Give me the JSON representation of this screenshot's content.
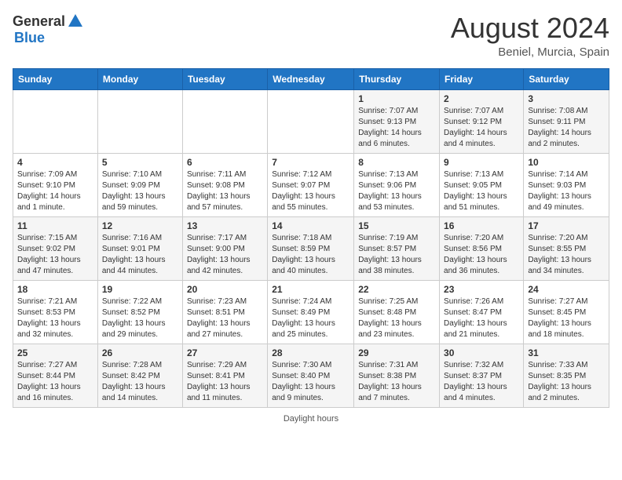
{
  "header": {
    "logo_general": "General",
    "logo_blue": "Blue",
    "month_year": "August 2024",
    "location": "Beniel, Murcia, Spain"
  },
  "weekdays": [
    "Sunday",
    "Monday",
    "Tuesday",
    "Wednesday",
    "Thursday",
    "Friday",
    "Saturday"
  ],
  "weeks": [
    [
      null,
      null,
      null,
      null,
      {
        "day": "1",
        "sunrise": "7:07 AM",
        "sunset": "9:13 PM",
        "daylight": "14 hours and 6 minutes."
      },
      {
        "day": "2",
        "sunrise": "7:07 AM",
        "sunset": "9:12 PM",
        "daylight": "14 hours and 4 minutes."
      },
      {
        "day": "3",
        "sunrise": "7:08 AM",
        "sunset": "9:11 PM",
        "daylight": "14 hours and 2 minutes."
      }
    ],
    [
      {
        "day": "4",
        "sunrise": "7:09 AM",
        "sunset": "9:10 PM",
        "daylight": "14 hours and 1 minute."
      },
      {
        "day": "5",
        "sunrise": "7:10 AM",
        "sunset": "9:09 PM",
        "daylight": "13 hours and 59 minutes."
      },
      {
        "day": "6",
        "sunrise": "7:11 AM",
        "sunset": "9:08 PM",
        "daylight": "13 hours and 57 minutes."
      },
      {
        "day": "7",
        "sunrise": "7:12 AM",
        "sunset": "9:07 PM",
        "daylight": "13 hours and 55 minutes."
      },
      {
        "day": "8",
        "sunrise": "7:13 AM",
        "sunset": "9:06 PM",
        "daylight": "13 hours and 53 minutes."
      },
      {
        "day": "9",
        "sunrise": "7:13 AM",
        "sunset": "9:05 PM",
        "daylight": "13 hours and 51 minutes."
      },
      {
        "day": "10",
        "sunrise": "7:14 AM",
        "sunset": "9:03 PM",
        "daylight": "13 hours and 49 minutes."
      }
    ],
    [
      {
        "day": "11",
        "sunrise": "7:15 AM",
        "sunset": "9:02 PM",
        "daylight": "13 hours and 47 minutes."
      },
      {
        "day": "12",
        "sunrise": "7:16 AM",
        "sunset": "9:01 PM",
        "daylight": "13 hours and 44 minutes."
      },
      {
        "day": "13",
        "sunrise": "7:17 AM",
        "sunset": "9:00 PM",
        "daylight": "13 hours and 42 minutes."
      },
      {
        "day": "14",
        "sunrise": "7:18 AM",
        "sunset": "8:59 PM",
        "daylight": "13 hours and 40 minutes."
      },
      {
        "day": "15",
        "sunrise": "7:19 AM",
        "sunset": "8:57 PM",
        "daylight": "13 hours and 38 minutes."
      },
      {
        "day": "16",
        "sunrise": "7:20 AM",
        "sunset": "8:56 PM",
        "daylight": "13 hours and 36 minutes."
      },
      {
        "day": "17",
        "sunrise": "7:20 AM",
        "sunset": "8:55 PM",
        "daylight": "13 hours and 34 minutes."
      }
    ],
    [
      {
        "day": "18",
        "sunrise": "7:21 AM",
        "sunset": "8:53 PM",
        "daylight": "13 hours and 32 minutes."
      },
      {
        "day": "19",
        "sunrise": "7:22 AM",
        "sunset": "8:52 PM",
        "daylight": "13 hours and 29 minutes."
      },
      {
        "day": "20",
        "sunrise": "7:23 AM",
        "sunset": "8:51 PM",
        "daylight": "13 hours and 27 minutes."
      },
      {
        "day": "21",
        "sunrise": "7:24 AM",
        "sunset": "8:49 PM",
        "daylight": "13 hours and 25 minutes."
      },
      {
        "day": "22",
        "sunrise": "7:25 AM",
        "sunset": "8:48 PM",
        "daylight": "13 hours and 23 minutes."
      },
      {
        "day": "23",
        "sunrise": "7:26 AM",
        "sunset": "8:47 PM",
        "daylight": "13 hours and 21 minutes."
      },
      {
        "day": "24",
        "sunrise": "7:27 AM",
        "sunset": "8:45 PM",
        "daylight": "13 hours and 18 minutes."
      }
    ],
    [
      {
        "day": "25",
        "sunrise": "7:27 AM",
        "sunset": "8:44 PM",
        "daylight": "13 hours and 16 minutes."
      },
      {
        "day": "26",
        "sunrise": "7:28 AM",
        "sunset": "8:42 PM",
        "daylight": "13 hours and 14 minutes."
      },
      {
        "day": "27",
        "sunrise": "7:29 AM",
        "sunset": "8:41 PM",
        "daylight": "13 hours and 11 minutes."
      },
      {
        "day": "28",
        "sunrise": "7:30 AM",
        "sunset": "8:40 PM",
        "daylight": "13 hours and 9 minutes."
      },
      {
        "day": "29",
        "sunrise": "7:31 AM",
        "sunset": "8:38 PM",
        "daylight": "13 hours and 7 minutes."
      },
      {
        "day": "30",
        "sunrise": "7:32 AM",
        "sunset": "8:37 PM",
        "daylight": "13 hours and 4 minutes."
      },
      {
        "day": "31",
        "sunrise": "7:33 AM",
        "sunset": "8:35 PM",
        "daylight": "13 hours and 2 minutes."
      }
    ]
  ],
  "footer": {
    "daylight_hours": "Daylight hours"
  }
}
